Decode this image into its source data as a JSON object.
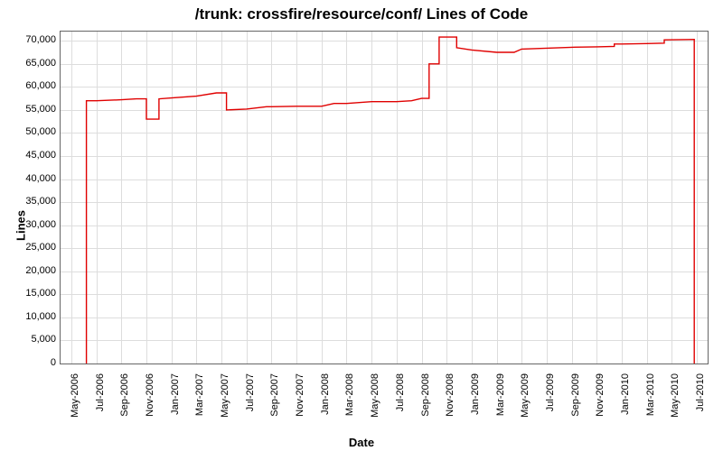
{
  "chart_data": {
    "type": "line",
    "title": "/trunk: crossfire/resource/conf/ Lines of Code",
    "xlabel": "Date",
    "ylabel": "Lines",
    "ylim": [
      0,
      72000
    ],
    "y_ticks": [
      0,
      5000,
      10000,
      15000,
      20000,
      25000,
      30000,
      35000,
      40000,
      45000,
      50000,
      55000,
      60000,
      65000,
      70000
    ],
    "y_tick_labels": [
      "0",
      "5,000",
      "10,000",
      "15,000",
      "20,000",
      "25,000",
      "30,000",
      "35,000",
      "40,000",
      "45,000",
      "50,000",
      "55,000",
      "60,000",
      "65,000",
      "70,000"
    ],
    "x_categories": [
      "May-2006",
      "Jul-2006",
      "Sep-2006",
      "Nov-2006",
      "Jan-2007",
      "Mar-2007",
      "May-2007",
      "Jul-2007",
      "Sep-2007",
      "Nov-2007",
      "Jan-2008",
      "Mar-2008",
      "May-2008",
      "Jul-2008",
      "Sep-2008",
      "Nov-2008",
      "Jan-2009",
      "Mar-2009",
      "May-2009",
      "Jul-2009",
      "Sep-2009",
      "Nov-2009",
      "Jan-2010",
      "Mar-2010",
      "May-2010",
      "Jul-2010"
    ],
    "series": [
      {
        "name": "Lines",
        "color": "#e00000",
        "points": [
          {
            "xi": 0.6,
            "y": 0
          },
          {
            "xi": 0.6,
            "y": 57000
          },
          {
            "xi": 1.0,
            "y": 57000
          },
          {
            "xi": 2.0,
            "y": 57200
          },
          {
            "xi": 2.6,
            "y": 57400
          },
          {
            "xi": 3.0,
            "y": 57400
          },
          {
            "xi": 3.0,
            "y": 53000
          },
          {
            "xi": 3.5,
            "y": 53000
          },
          {
            "xi": 3.5,
            "y": 57400
          },
          {
            "xi": 4.0,
            "y": 57600
          },
          {
            "xi": 5.0,
            "y": 58000
          },
          {
            "xi": 5.8,
            "y": 58700
          },
          {
            "xi": 6.2,
            "y": 58700
          },
          {
            "xi": 6.2,
            "y": 55000
          },
          {
            "xi": 7.0,
            "y": 55200
          },
          {
            "xi": 7.8,
            "y": 55700
          },
          {
            "xi": 8.0,
            "y": 55700
          },
          {
            "xi": 9.0,
            "y": 55800
          },
          {
            "xi": 10.0,
            "y": 55800
          },
          {
            "xi": 10.5,
            "y": 56400
          },
          {
            "xi": 11.0,
            "y": 56400
          },
          {
            "xi": 12.0,
            "y": 56800
          },
          {
            "xi": 13.0,
            "y": 56800
          },
          {
            "xi": 13.6,
            "y": 57000
          },
          {
            "xi": 14.0,
            "y": 57500
          },
          {
            "xi": 14.3,
            "y": 57500
          },
          {
            "xi": 14.3,
            "y": 65000
          },
          {
            "xi": 14.7,
            "y": 65000
          },
          {
            "xi": 14.7,
            "y": 70800
          },
          {
            "xi": 15.4,
            "y": 70800
          },
          {
            "xi": 15.4,
            "y": 68500
          },
          {
            "xi": 16.0,
            "y": 68000
          },
          {
            "xi": 17.0,
            "y": 67500
          },
          {
            "xi": 17.7,
            "y": 67500
          },
          {
            "xi": 18.0,
            "y": 68200
          },
          {
            "xi": 19.0,
            "y": 68400
          },
          {
            "xi": 20.0,
            "y": 68600
          },
          {
            "xi": 21.0,
            "y": 68700
          },
          {
            "xi": 21.7,
            "y": 68800
          },
          {
            "xi": 21.7,
            "y": 69300
          },
          {
            "xi": 22.0,
            "y": 69300
          },
          {
            "xi": 23.0,
            "y": 69400
          },
          {
            "xi": 23.7,
            "y": 69500
          },
          {
            "xi": 23.7,
            "y": 70200
          },
          {
            "xi": 24.9,
            "y": 70300
          },
          {
            "xi": 24.9,
            "y": 0
          }
        ]
      }
    ]
  }
}
